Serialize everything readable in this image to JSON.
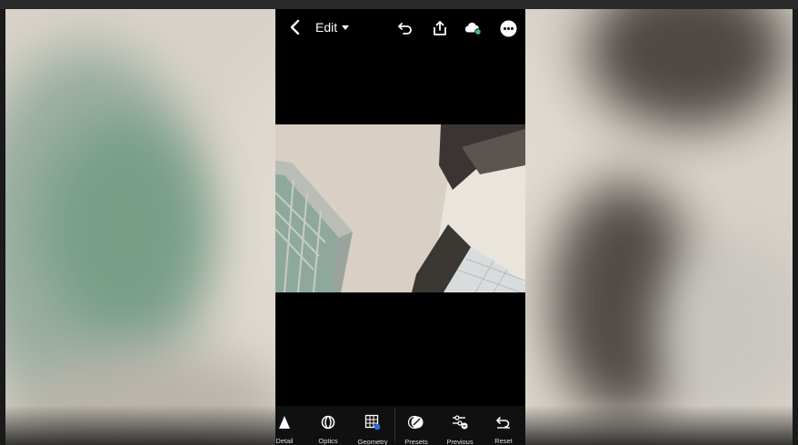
{
  "header": {
    "title": "Edit",
    "back_icon": "chevron-left-icon",
    "undo_icon": "undo-icon",
    "share_icon": "share-icon",
    "cloud_icon": "cloud-sync-icon",
    "more_icon": "more-icon"
  },
  "toolbar": {
    "items": [
      {
        "label": "Detail",
        "icon": "detail-icon"
      },
      {
        "label": "Optics",
        "icon": "optics-icon"
      },
      {
        "label": "Geometry",
        "icon": "geometry-icon"
      },
      {
        "label": "Presets",
        "icon": "presets-icon"
      },
      {
        "label": "Previous",
        "icon": "previous-icon"
      },
      {
        "label": "Reset",
        "icon": "reset-icon"
      }
    ]
  },
  "colors": {
    "cloud_status": "#3fbf6f",
    "app_background": "#000000"
  }
}
